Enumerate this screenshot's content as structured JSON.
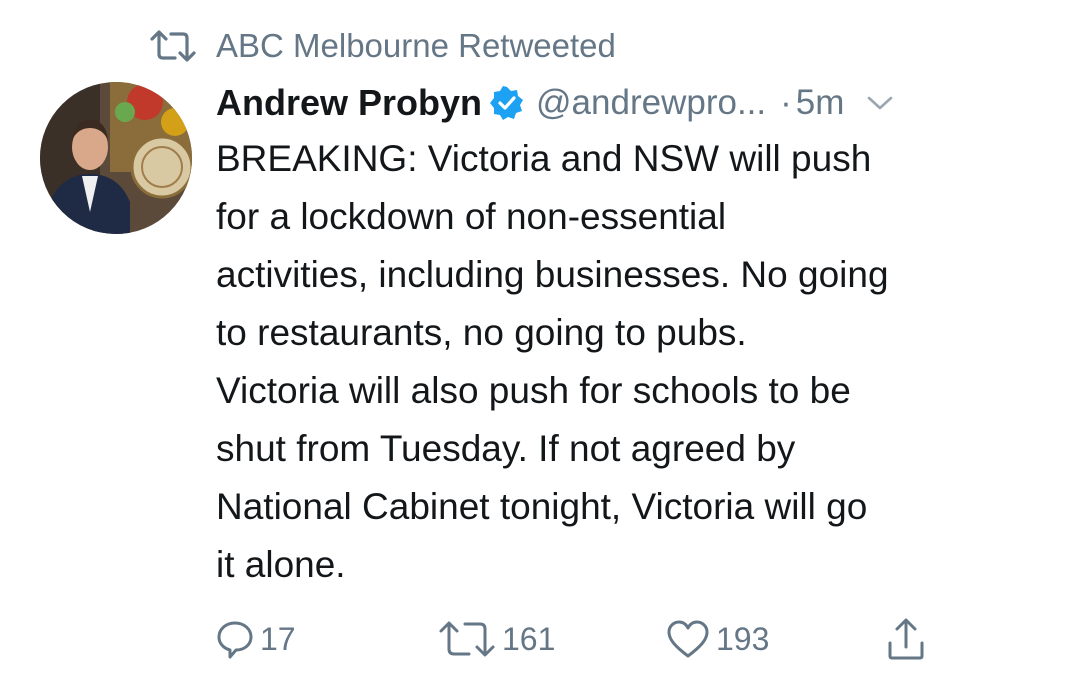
{
  "retweet_header": {
    "text": "ABC Melbourne Retweeted",
    "icon": "retweet-icon"
  },
  "tweet": {
    "author_name": "Andrew Probyn",
    "verified": true,
    "handle": "@andrewpro...",
    "separator": "·",
    "time": "5m",
    "body_lines": [
      "BREAKING: Victoria and NSW will push",
      "for a lockdown of non-essential",
      "activities, including businesses. No going",
      "to restaurants, no going to pubs.",
      "Victoria will also push for schools to be",
      "shut from Tuesday. If not agreed by",
      "National Cabinet tonight, Victoria will go",
      "it alone."
    ]
  },
  "actions": {
    "reply_count": "17",
    "retweet_count": "161",
    "like_count": "193"
  },
  "colors": {
    "text": "#14171a",
    "secondary": "#657786",
    "verified_blue": "#1da1f2",
    "background": "#ffffff"
  }
}
